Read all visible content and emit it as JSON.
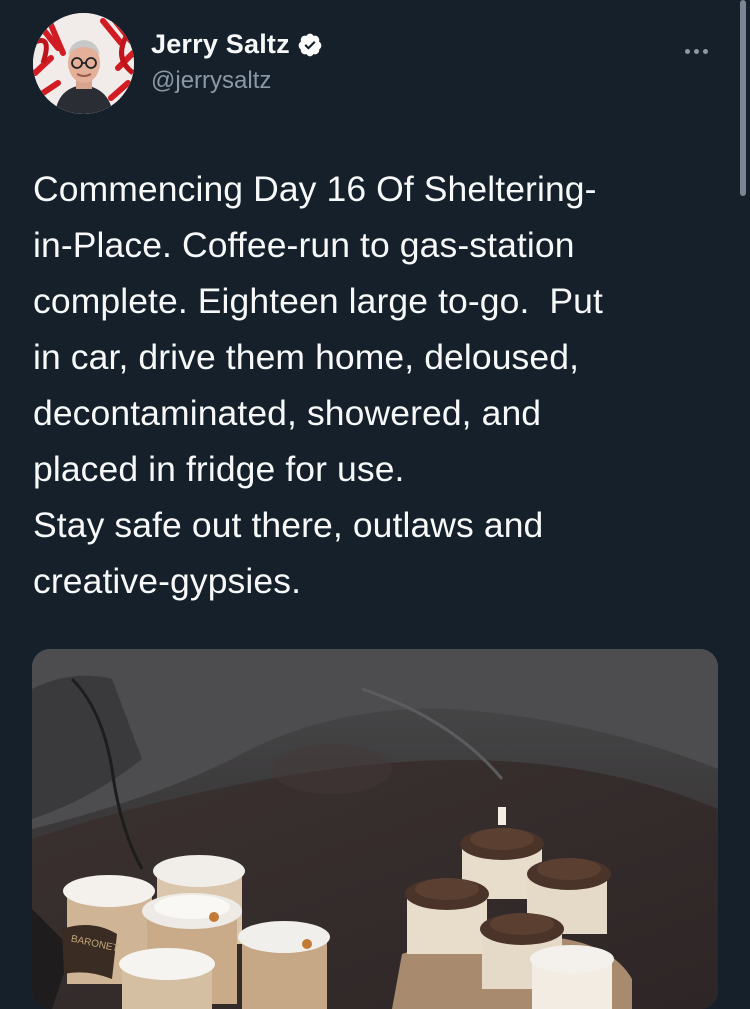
{
  "user": {
    "display_name": "Jerry Saltz",
    "handle": "@jerrysaltz",
    "verified": true,
    "avatar_icon": "profile-photo",
    "verified_icon": "verified-badge-icon"
  },
  "more_icon": "more-options-icon",
  "tweet": {
    "text": "Commencing Day 16 Of Sheltering-\nin-Place. Coffee-run to gas-station\ncomplete. Eighteen large to-go.  Put\nin car, drive them home, deloused,\ndecontaminated, showered, and\nplaced in fridge for use.\nStay safe out there, outlaws and\ncreative-gypsies."
  },
  "media": {
    "type": "photo",
    "description_icon": "coffee-cups-photo",
    "cup_brand_text": "BARONET"
  },
  "colors": {
    "background": "#15202b",
    "text": "#f7f9f9",
    "secondary_text": "#8b98a5",
    "verified": "#ffffff"
  }
}
